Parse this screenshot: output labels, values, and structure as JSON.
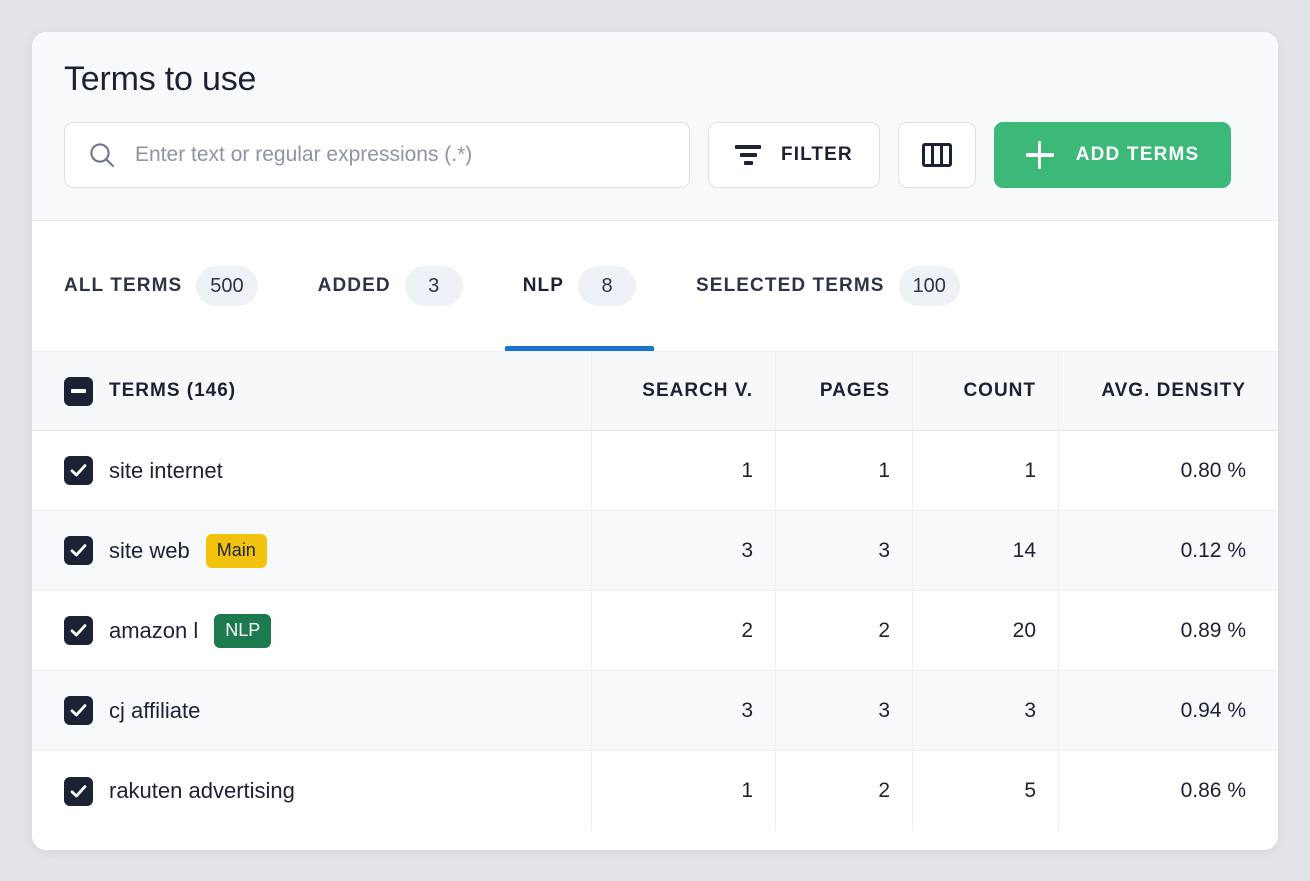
{
  "panel": {
    "title": "Terms to use"
  },
  "search": {
    "placeholder": "Enter text or regular expressions (.*)",
    "value": "",
    "icon": "search-icon"
  },
  "toolbar": {
    "filter_label": "FILTER",
    "filter_icon": "filter-icon",
    "columns_icon": "columns-icon",
    "add_terms_label": "ADD TERMS",
    "add_terms_icon": "plus-icon",
    "accent_green": "#3cb878"
  },
  "tabs": {
    "active_index": 2,
    "active_underline_color": "#1a73cc",
    "items": [
      {
        "label": "ALL TERMS",
        "count": "500"
      },
      {
        "label": "ADDED",
        "count": "3"
      },
      {
        "label": "NLP",
        "count": "8"
      },
      {
        "label": "SELECTED TERMS",
        "count": "100"
      }
    ]
  },
  "table": {
    "header": {
      "checkbox_state": "indeterminate",
      "terms": "TERMS (146)",
      "search_volume": "SEARCH V.",
      "pages": "PAGES",
      "count": "COUNT",
      "avg_density": "AVG. DENSITY"
    },
    "rows": [
      {
        "checked": true,
        "term": "site internet",
        "badge": null,
        "badge_type": null,
        "search_volume": "1",
        "pages": "1",
        "count": "1",
        "avg_density": "0.80 %"
      },
      {
        "checked": true,
        "term": "site web",
        "badge": "Main",
        "badge_type": "main",
        "search_volume": "3",
        "pages": "3",
        "count": "14",
        "avg_density": "0.12 %"
      },
      {
        "checked": true,
        "term": "amazon l",
        "badge": "NLP",
        "badge_type": "nlp",
        "search_volume": "2",
        "pages": "2",
        "count": "20",
        "avg_density": "0.89 %"
      },
      {
        "checked": true,
        "term": "cj affiliate",
        "badge": null,
        "badge_type": null,
        "search_volume": "3",
        "pages": "3",
        "count": "3",
        "avg_density": "0.94 %"
      },
      {
        "checked": true,
        "term": "rakuten advertising",
        "badge": null,
        "badge_type": null,
        "search_volume": "1",
        "pages": "2",
        "count": "5",
        "avg_density": "0.86 %"
      }
    ]
  },
  "colors": {
    "badge_main": "#f2c20c",
    "badge_nlp": "#1d7a4c",
    "checkbox": "#1b2233",
    "page_background": "#e2e4e9",
    "card_background": "#f8f9fb"
  }
}
